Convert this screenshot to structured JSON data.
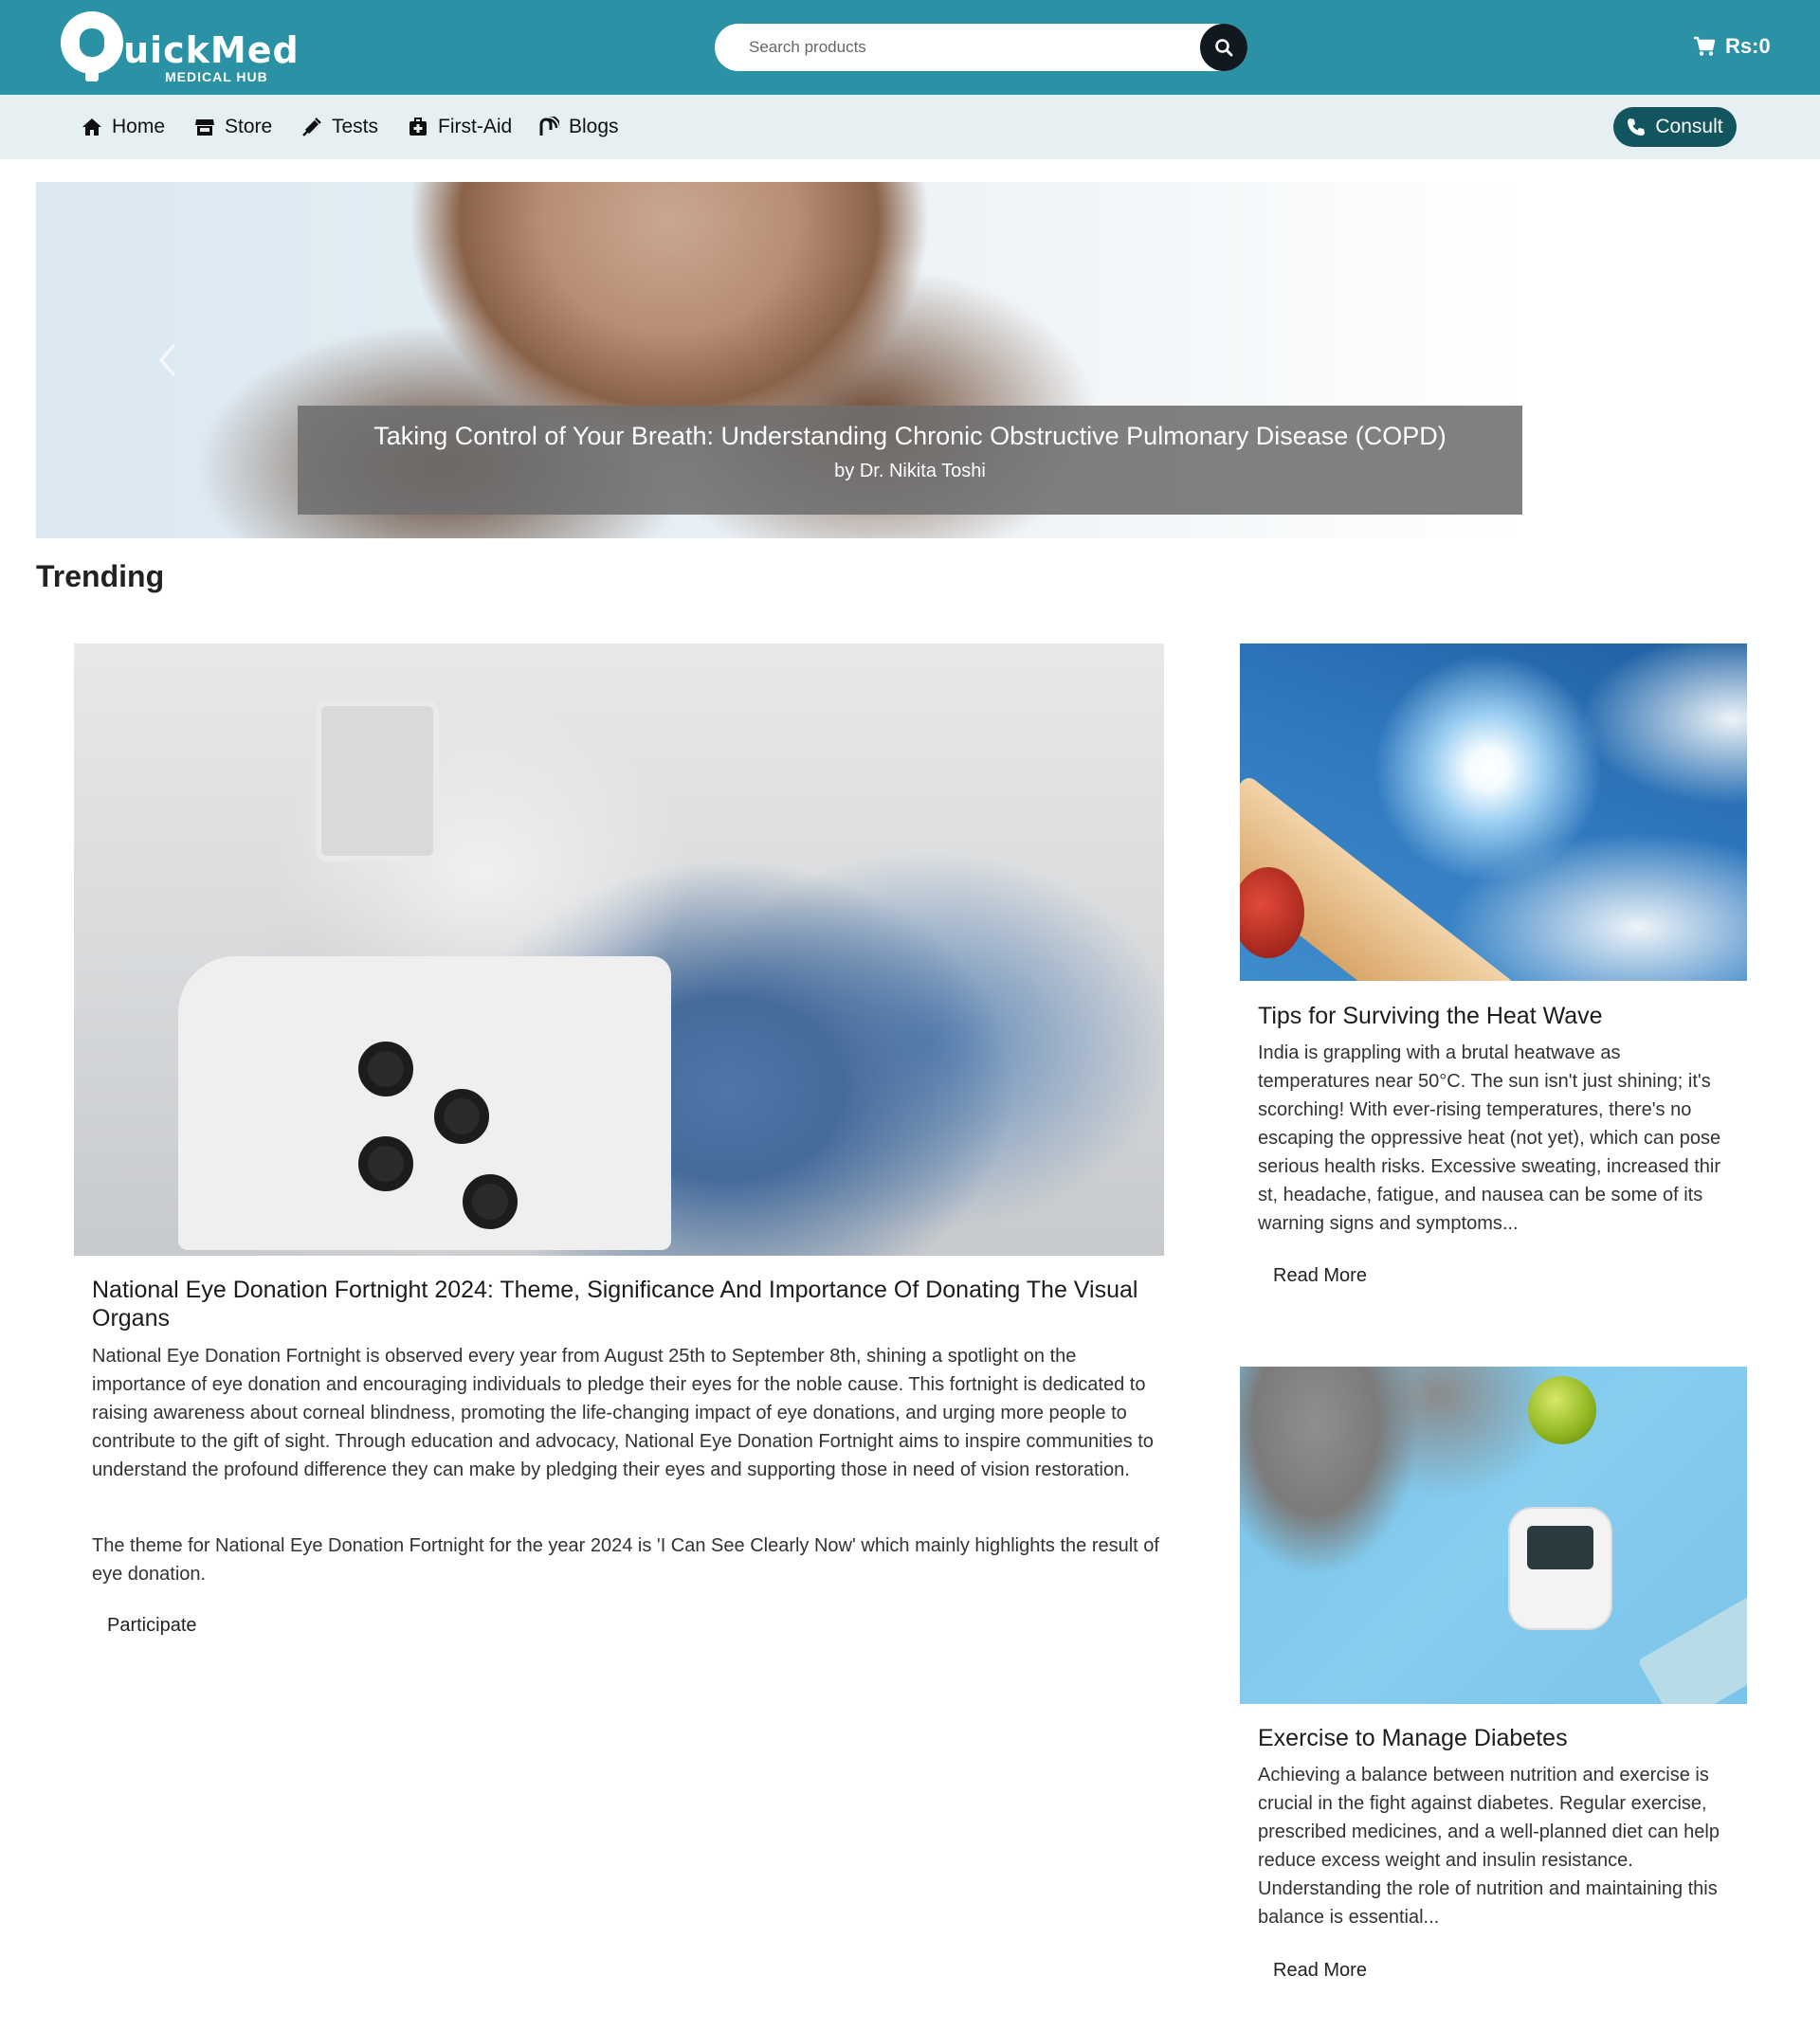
{
  "header": {
    "logo_text": "uickMed",
    "logo_subtitle": "MEDICAL HUB",
    "search_placeholder": "Search products",
    "cart_total": "Rs:0"
  },
  "nav": {
    "items": [
      {
        "label": "Home",
        "icon": "home-icon"
      },
      {
        "label": "Store",
        "icon": "store-icon"
      },
      {
        "label": "Tests",
        "icon": "syringe-icon"
      },
      {
        "label": "First-Aid",
        "icon": "first-aid-kit-icon"
      },
      {
        "label": "Blogs",
        "icon": "blog-icon"
      }
    ],
    "consult_label": "Consult"
  },
  "hero": {
    "title": "Taking Control of Your Breath: Understanding Chronic Obstructive Pulmonary Disease (COPD)",
    "author": "by Dr. Nikita Toshi"
  },
  "trending": {
    "heading": "Trending",
    "main": {
      "title": "National Eye Donation Fortnight 2024: Theme, Significance And Importance Of Donating The Visual Organs",
      "paragraph1": "National Eye Donation Fortnight is observed every year from August 25th to September 8th, shining a spotlight on the importance of eye donation and encouraging individuals to pledge their eyes for the noble cause. This fortnight is dedicated to raising awareness about corneal blindness, promoting the life-changing impact of eye donations, and urging more people to contribute to the gift of sight. Through education and advocacy, National Eye Donation Fortnight aims to inspire communities to understand the profound difference they can make by pledging their eyes and supporting those in need of vision restoration.",
      "paragraph2": "The theme for National Eye Donation Fortnight for the year 2024 is 'I Can See Clearly Now' which mainly highlights the result of eye donation.",
      "action": "Participate"
    },
    "side": [
      {
        "title": "Tips for Surviving the Heat Wave",
        "text": "India is grappling with a brutal heatwave as temperatures near 50°C. The sun isn't just shining; it's scorching! With ever-rising temperatures, there's no escaping the oppressive heat (not yet), which can pose serious health risks. Excessive sweating, increased thir st, headache, fatigue, and nausea can be some of its warning signs and symptoms...",
        "action": "Read More"
      },
      {
        "title": "Exercise to Manage Diabetes",
        "text": "Achieving a balance between nutrition and exercise is crucial in the fight against diabetes. Regular exercise, prescribed medicines, and a well-planned diet can help reduce excess weight and insulin resistance. Understanding the role of nutrition and maintaining this balance is essential...",
        "action": "Read More"
      }
    ]
  },
  "colors": {
    "header_bg": "#2b92a6",
    "nav_bg": "#e6f0f3",
    "consult_bg": "#13555e",
    "search_button_bg": "#12181f"
  }
}
